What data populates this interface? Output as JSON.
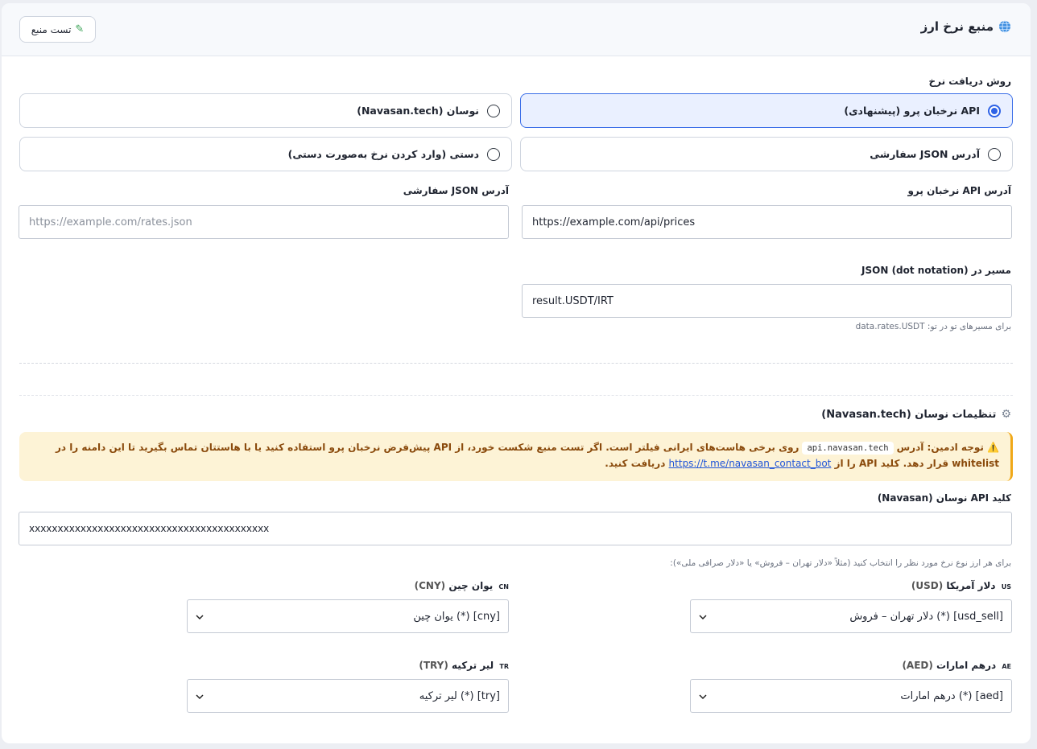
{
  "header": {
    "title": "منبع نرخ ارز",
    "test_button": "تست منبع"
  },
  "method": {
    "label": "روش دریافت نرخ",
    "options": [
      {
        "label": "API نرخبان پرو (پیشنهادی)",
        "selected": true
      },
      {
        "label": "نوسان (Navasan.tech)",
        "selected": false
      },
      {
        "label": "آدرس JSON سفارشی",
        "selected": false
      },
      {
        "label": "دستی (وارد کردن نرخ به‌صورت دستی)",
        "selected": false
      }
    ]
  },
  "api_url": {
    "label": "آدرس API نرخبان پرو",
    "value": "https://example.com/api/prices"
  },
  "json_url": {
    "label": "آدرس JSON سفارشی",
    "placeholder": "https://example.com/rates.json"
  },
  "json_path": {
    "label": "مسیر در JSON (dot notation)",
    "value": "result.USDT/IRT",
    "hint": "برای مسیرهای تو در تو: data.rates.USDT"
  },
  "navasan": {
    "title": "تنظیمات نوسان (Navasan.tech)",
    "warning": {
      "prefix": "⚠️ توجه ادمین: آدرس",
      "code": "api.navasan.tech",
      "body": "روی برخی هاست‌های ایرانی فیلتر است. اگر تست منبع شکست خورد، از API پیش‌فرض نرخبان پرو استفاده کنید یا با هاستتان تماس بگیرید تا این دامنه را در whitelist قرار دهد. کلید API را از",
      "link": "https://t.me/navasan_contact_bot",
      "suffix": "دریافت کنید."
    },
    "api_key_label": "کلید API نوسان (Navasan)",
    "api_key_value": "xxxxxxxxxxxxxxxxxxxxxxxxxxxxxxxxxxxxxxxxxx",
    "currency_hint": "برای هر ارز نوع نرخ مورد نظر را انتخاب کنید (مثلاً «دلار تهران – فروش» یا «دلار صرافی ملی»):",
    "currencies": {
      "usd": {
        "flag": "US",
        "name": "دلار آمریکا",
        "code": "(USD)",
        "selected": "[usd_sell] (*) دلار تهران – فروش"
      },
      "cny": {
        "flag": "CN",
        "name": "یوان چین",
        "code": "(CNY)",
        "selected": "[cny] (*) یوان چین"
      },
      "aed": {
        "flag": "AE",
        "name": "درهم امارات",
        "code": "(AED)",
        "selected": "[aed] (*) درهم امارات"
      },
      "try": {
        "flag": "TR",
        "name": "لیر ترکیه",
        "code": "(TRY)",
        "selected": "[try] (*) لیر ترکیه"
      }
    }
  }
}
